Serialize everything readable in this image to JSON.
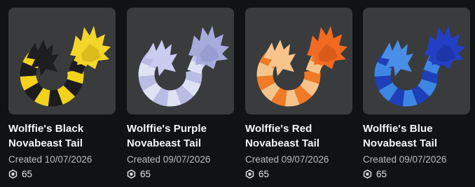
{
  "items": [
    {
      "name": "Wolffie's Black Novabeast Tail",
      "created": "Created 10/07/2026",
      "price": "65",
      "colors": {
        "stripe_a": "#f2d21a",
        "stripe_b": "#1c1c1e",
        "head": "#f4d62a",
        "head_shade": "#c8a710",
        "tuft": "#1e1e20"
      }
    },
    {
      "name": "Wolffie's Purple Novabeast Tail",
      "created": "Created 09/07/2026",
      "price": "65",
      "colors": {
        "stripe_a": "#b9bde6",
        "stripe_b": "#dfe1f4",
        "head": "#a7abdc",
        "head_shade": "#8c90c8",
        "tuft": "#c9ccee"
      }
    },
    {
      "name": "Wolffie's Red Novabeast Tail",
      "created": "Created 09/07/2026",
      "price": "65",
      "colors": {
        "stripe_a": "#f07a26",
        "stripe_b": "#f5c48a",
        "head": "#f06a22",
        "head_shade": "#c94f12",
        "tuft": "#f7c58c"
      }
    },
    {
      "name": "Wolffie's Blue Novabeast Tail",
      "created": "Created 09/07/2026",
      "price": "65",
      "colors": {
        "stripe_a": "#1e3fb8",
        "stripe_b": "#3d86e6",
        "head": "#2340c4",
        "head_shade": "#172d95",
        "tuft": "#4a8ee8"
      }
    }
  ],
  "icons": {
    "price_icon": "robux-icon"
  }
}
